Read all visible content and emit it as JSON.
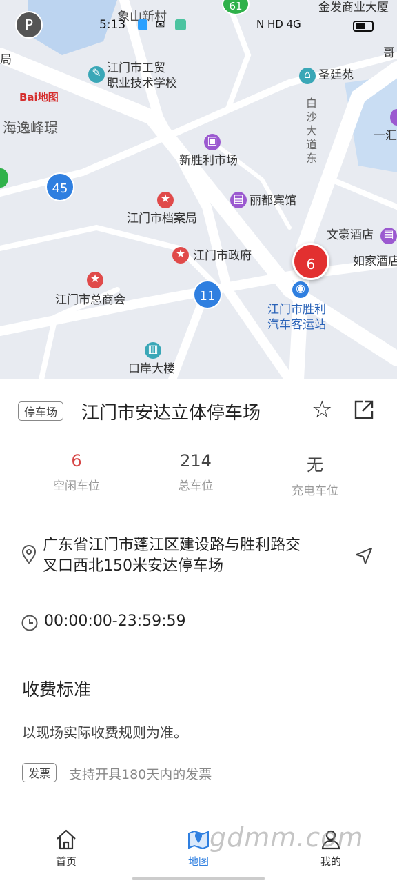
{
  "status_bar": {
    "time": "5:13",
    "right": "N  HD 4G"
  },
  "map": {
    "logo": "Bai地图",
    "pois": [
      {
        "name": "象山新村"
      },
      {
        "name": "金发商业大厦"
      },
      {
        "name": "江门市工贸\n职业技术学校"
      },
      {
        "name": "圣廷苑"
      },
      {
        "name": "海逸峰璟"
      },
      {
        "name": "新胜利市场"
      },
      {
        "name": "丽都宾馆"
      },
      {
        "name": "江门市档案局"
      },
      {
        "name": "文豪酒店"
      },
      {
        "name": "江门市政府"
      },
      {
        "name": "如家酒店"
      },
      {
        "name": "江门市总商会"
      },
      {
        "name": "江门市胜利\n汽车客运站"
      },
      {
        "name": "口岸大楼"
      },
      {
        "name": "白沙大道东"
      },
      {
        "name": "一汇"
      },
      {
        "name": "局"
      },
      {
        "name": "哥"
      }
    ],
    "markers": {
      "p45": "45",
      "p61": "61",
      "p11": "11",
      "selected": "6"
    }
  },
  "panel": {
    "tag": "停车场",
    "title": "江门市安达立体停车场",
    "stats": [
      {
        "value": "6",
        "label": "空闲车位"
      },
      {
        "value": "214",
        "label": "总车位"
      },
      {
        "value": "无",
        "label": "充电车位"
      }
    ],
    "address": "广东省江门市蓬江区建设路与胜利路交叉口西北150米安达停车场",
    "hours": "00:00:00-23:59:59",
    "fee_title": "收费标准",
    "fee_text": "以现场实际收费规则为准。",
    "invoice_tag": "发票",
    "invoice_text": "支持开具180天内的发票"
  },
  "bottom_nav": [
    {
      "label": "首页"
    },
    {
      "label": "地图"
    },
    {
      "label": "我的"
    }
  ],
  "watermark": "gdmm.com",
  "colors": {
    "accent": "#2f7fe0",
    "red": "#e23030",
    "text": "#222"
  }
}
